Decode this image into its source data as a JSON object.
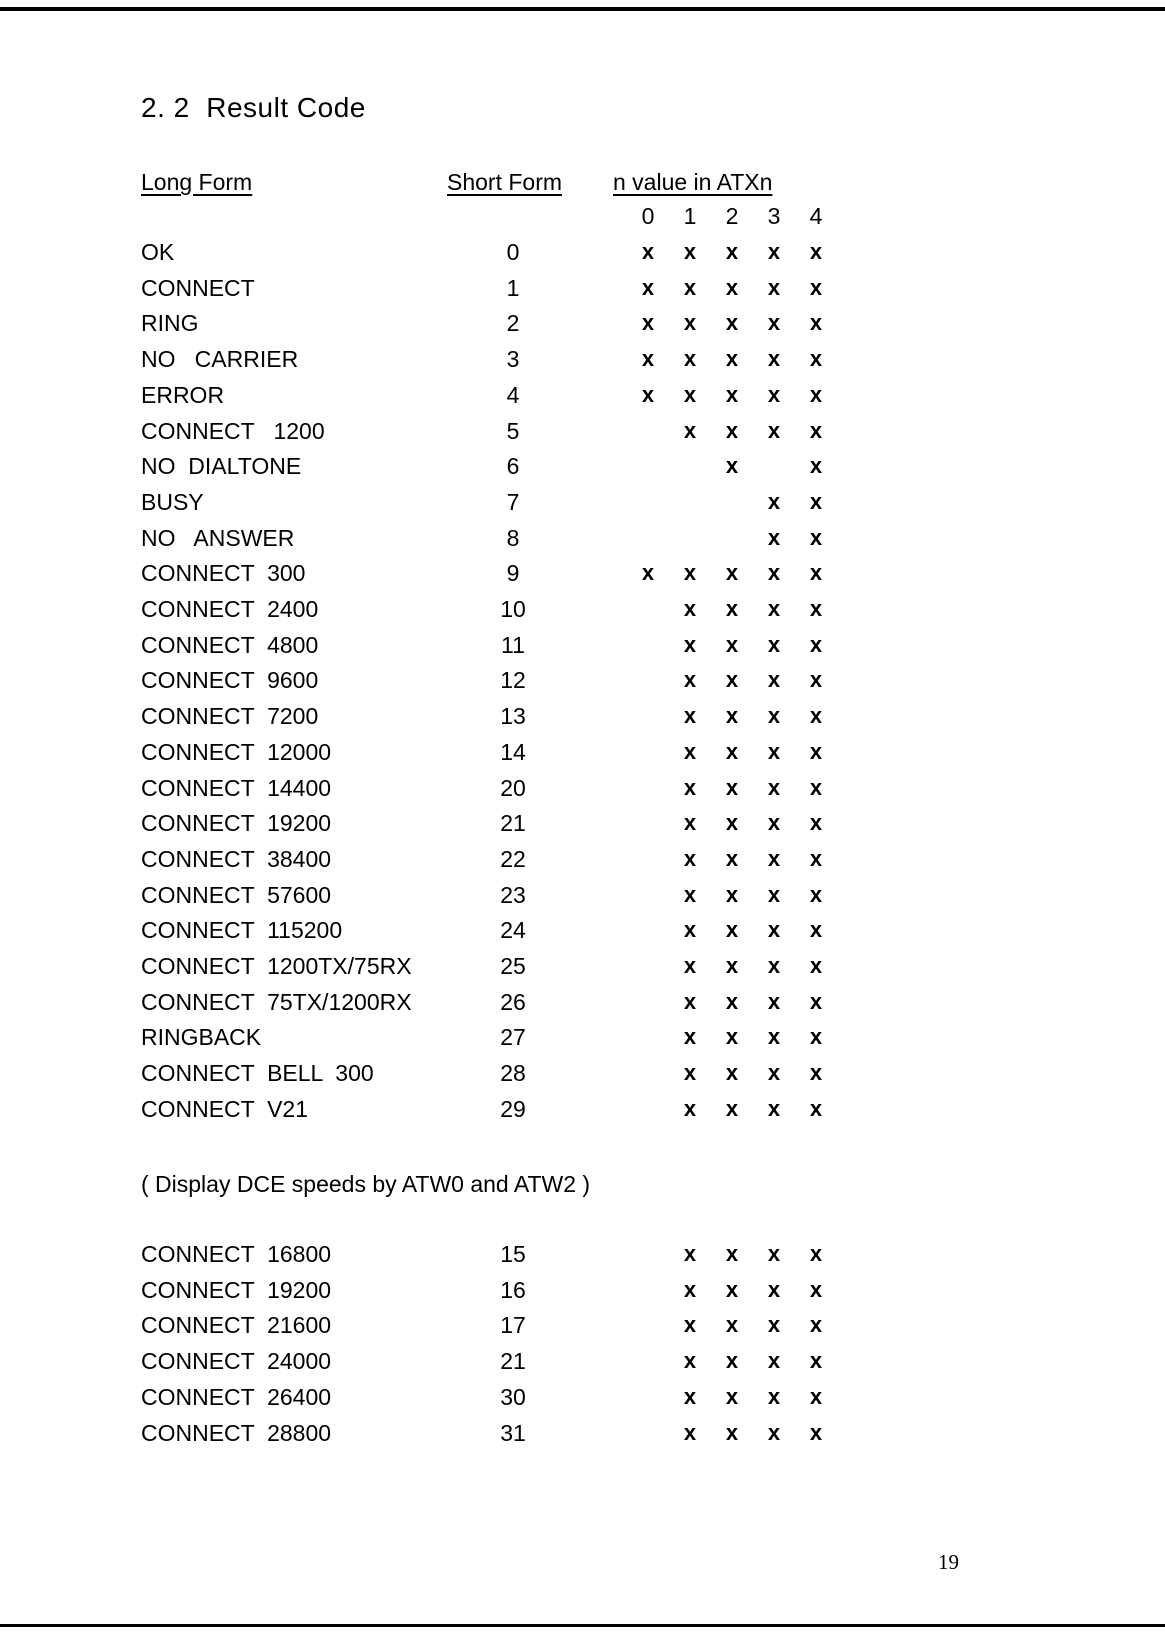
{
  "document": {
    "title": "2. 2  Result Code",
    "page_number": "19",
    "note": "( Display DCE speeds by ATW0 and ATW2 )"
  },
  "table": {
    "headers": {
      "long_form": "Long Form",
      "short_form": "Short Form",
      "n_value": "n value in ATXn"
    },
    "n_columns": [
      "0",
      "1",
      "2",
      "3",
      "4"
    ],
    "mark_symbol": "x",
    "rows": [
      {
        "long_form": "OK",
        "short_form": "0",
        "marks": [
          true,
          true,
          true,
          true,
          true
        ]
      },
      {
        "long_form": "CONNECT",
        "short_form": "1",
        "marks": [
          true,
          true,
          true,
          true,
          true
        ]
      },
      {
        "long_form": "RING",
        "short_form": "2",
        "marks": [
          true,
          true,
          true,
          true,
          true
        ]
      },
      {
        "long_form": "NO   CARRIER",
        "short_form": "3",
        "marks": [
          true,
          true,
          true,
          true,
          true
        ]
      },
      {
        "long_form": "ERROR",
        "short_form": "4",
        "marks": [
          true,
          true,
          true,
          true,
          true
        ]
      },
      {
        "long_form": "CONNECT   1200",
        "short_form": "5",
        "marks": [
          false,
          true,
          true,
          true,
          true
        ]
      },
      {
        "long_form": "NO  DIALTONE",
        "short_form": "6",
        "marks": [
          false,
          false,
          true,
          false,
          true
        ]
      },
      {
        "long_form": "BUSY",
        "short_form": "7",
        "marks": [
          false,
          false,
          false,
          true,
          true
        ]
      },
      {
        "long_form": "NO   ANSWER",
        "short_form": "8",
        "marks": [
          false,
          false,
          false,
          true,
          true
        ]
      },
      {
        "long_form": "CONNECT  300",
        "short_form": "9",
        "marks": [
          true,
          true,
          true,
          true,
          true
        ]
      },
      {
        "long_form": "CONNECT  2400",
        "short_form": "10",
        "marks": [
          false,
          true,
          true,
          true,
          true
        ]
      },
      {
        "long_form": "CONNECT  4800",
        "short_form": "11",
        "marks": [
          false,
          true,
          true,
          true,
          true
        ]
      },
      {
        "long_form": "CONNECT  9600",
        "short_form": "12",
        "marks": [
          false,
          true,
          true,
          true,
          true
        ]
      },
      {
        "long_form": "CONNECT  7200",
        "short_form": "13",
        "marks": [
          false,
          true,
          true,
          true,
          true
        ]
      },
      {
        "long_form": "CONNECT  12000",
        "short_form": "14",
        "marks": [
          false,
          true,
          true,
          true,
          true
        ]
      },
      {
        "long_form": "CONNECT  14400",
        "short_form": "20",
        "marks": [
          false,
          true,
          true,
          true,
          true
        ]
      },
      {
        "long_form": "CONNECT  19200",
        "short_form": "21",
        "marks": [
          false,
          true,
          true,
          true,
          true
        ]
      },
      {
        "long_form": "CONNECT  38400",
        "short_form": "22",
        "marks": [
          false,
          true,
          true,
          true,
          true
        ]
      },
      {
        "long_form": "CONNECT  57600",
        "short_form": "23",
        "marks": [
          false,
          true,
          true,
          true,
          true
        ]
      },
      {
        "long_form": "CONNECT  115200",
        "short_form": "24",
        "marks": [
          false,
          true,
          true,
          true,
          true
        ]
      },
      {
        "long_form": "CONNECT  1200TX/75RX",
        "short_form": "25",
        "marks": [
          false,
          true,
          true,
          true,
          true
        ]
      },
      {
        "long_form": "CONNECT  75TX/1200RX",
        "short_form": "26",
        "marks": [
          false,
          true,
          true,
          true,
          true
        ]
      },
      {
        "long_form": "RINGBACK",
        "short_form": "27",
        "marks": [
          false,
          true,
          true,
          true,
          true
        ]
      },
      {
        "long_form": "CONNECT  BELL  300",
        "short_form": "28",
        "marks": [
          false,
          true,
          true,
          true,
          true
        ]
      },
      {
        "long_form": "CONNECT  V21",
        "short_form": "29",
        "marks": [
          false,
          true,
          true,
          true,
          true
        ]
      }
    ],
    "dce_rows": [
      {
        "long_form": "CONNECT  16800",
        "short_form": "15",
        "marks": [
          false,
          true,
          true,
          true,
          true
        ]
      },
      {
        "long_form": "CONNECT  19200",
        "short_form": "16",
        "marks": [
          false,
          true,
          true,
          true,
          true
        ]
      },
      {
        "long_form": "CONNECT  21600",
        "short_form": "17",
        "marks": [
          false,
          true,
          true,
          true,
          true
        ]
      },
      {
        "long_form": "CONNECT  24000",
        "short_form": "21",
        "marks": [
          false,
          true,
          true,
          true,
          true
        ]
      },
      {
        "long_form": "CONNECT  26400",
        "short_form": "30",
        "marks": [
          false,
          true,
          true,
          true,
          true
        ]
      },
      {
        "long_form": "CONNECT  28800",
        "short_form": "31",
        "marks": [
          false,
          true,
          true,
          true,
          true
        ]
      }
    ]
  }
}
